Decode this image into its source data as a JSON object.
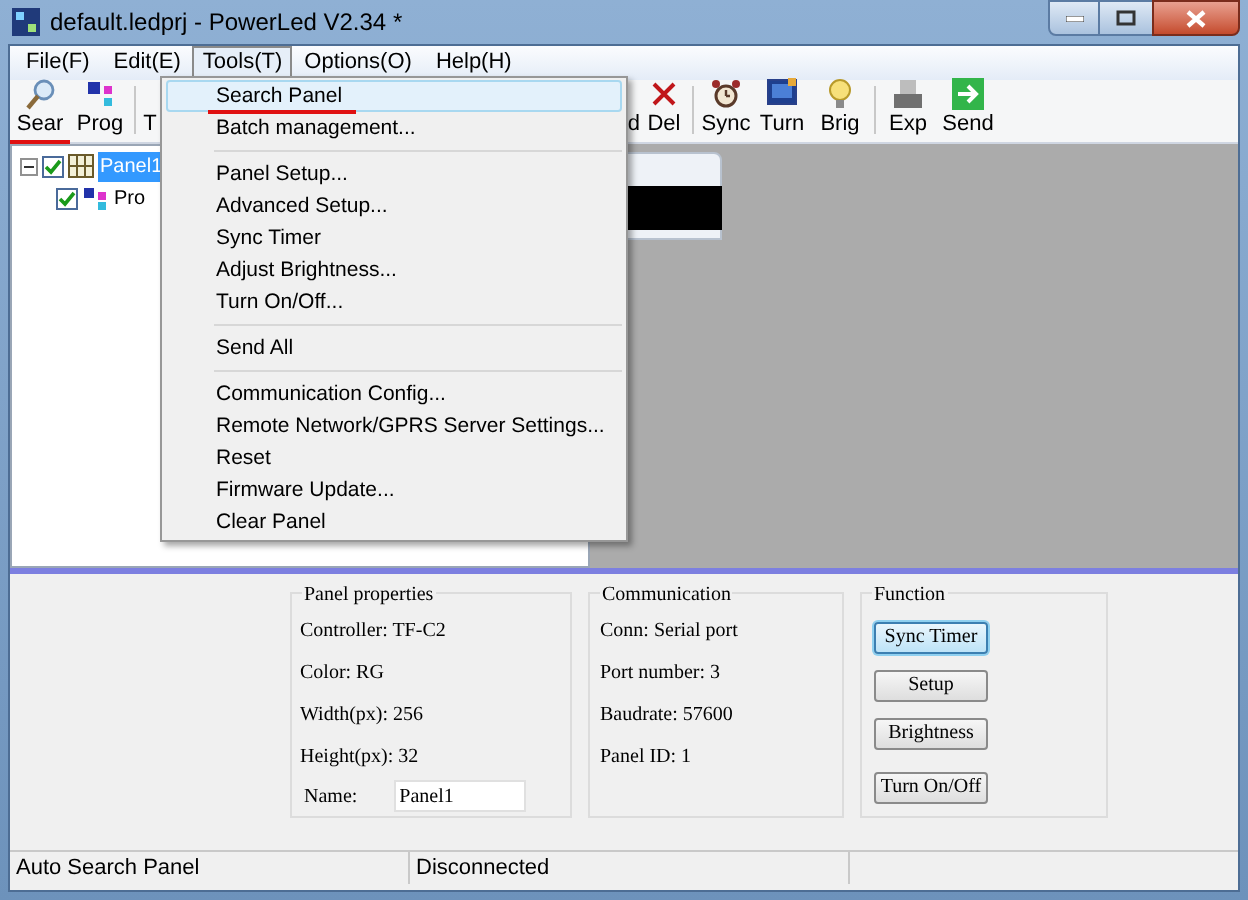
{
  "window": {
    "title": "default.ledprj - PowerLed V2.34 *"
  },
  "menu_bar": [
    {
      "label": "File(F)",
      "selected": false
    },
    {
      "label": "Edit(E)",
      "selected": false
    },
    {
      "label": "Tools(T)",
      "selected": true
    },
    {
      "label": "Options(O)",
      "selected": false
    },
    {
      "label": "Help(H)",
      "selected": false
    }
  ],
  "toolbar": [
    {
      "label": "Sear"
    },
    {
      "label": "Prog"
    },
    {
      "label": "T"
    },
    {
      "label": "d"
    },
    {
      "label": "Del"
    },
    {
      "label": "Sync"
    },
    {
      "label": "Turn"
    },
    {
      "label": "Brig"
    },
    {
      "label": "Exp"
    },
    {
      "label": "Send"
    }
  ],
  "tree": [
    {
      "label": "Panel1",
      "checked": true,
      "selected": true,
      "expanded": true,
      "children": [
        {
          "label": "Pro",
          "checked": true,
          "selected": false
        }
      ]
    }
  ],
  "tools_menu": [
    {
      "kind": "item",
      "label": "Search Panel",
      "highlighted": true,
      "annotated": true
    },
    {
      "kind": "item",
      "label": "Batch management...",
      "highlighted": false,
      "annotated": false
    },
    {
      "kind": "separator"
    },
    {
      "kind": "item",
      "label": "Panel Setup...",
      "highlighted": false,
      "annotated": false
    },
    {
      "kind": "item",
      "label": "Advanced Setup...",
      "highlighted": false,
      "annotated": false
    },
    {
      "kind": "item",
      "label": "Sync Timer",
      "highlighted": false,
      "annotated": false
    },
    {
      "kind": "item",
      "label": "Adjust Brightness...",
      "highlighted": false,
      "annotated": false
    },
    {
      "kind": "item",
      "label": "Turn On/Off...",
      "highlighted": false,
      "annotated": false
    },
    {
      "kind": "separator"
    },
    {
      "kind": "item",
      "label": "Send All",
      "highlighted": false,
      "annotated": false
    },
    {
      "kind": "separator"
    },
    {
      "kind": "item",
      "label": "Communication Config...",
      "highlighted": false,
      "annotated": false
    },
    {
      "kind": "item",
      "label": "Remote Network/GPRS Server Settings...",
      "highlighted": false,
      "annotated": false
    },
    {
      "kind": "item",
      "label": "Reset",
      "highlighted": false,
      "annotated": false
    },
    {
      "kind": "item",
      "label": "Firmware Update...",
      "highlighted": false,
      "annotated": false
    },
    {
      "kind": "item",
      "label": "Clear Panel",
      "highlighted": false,
      "annotated": false
    }
  ],
  "panel_properties": {
    "title": "Panel properties",
    "lines": [
      "Controller: TF-C2",
      "Color: RG",
      "Width(px): 256",
      "Height(px): 32"
    ],
    "name_label": "Name:",
    "name_value": "Panel1"
  },
  "communication": {
    "title": "Communication",
    "lines": [
      "Conn: Serial port",
      "Port number: 3",
      "Baudrate: 57600",
      "Panel ID: 1"
    ]
  },
  "function": {
    "title": "Function",
    "buttons": [
      {
        "label": "Sync Timer",
        "focused": true
      },
      {
        "label": "Setup",
        "focused": false
      },
      {
        "label": "Brightness",
        "focused": false
      },
      {
        "label": "Turn On/Off",
        "focused": false
      }
    ]
  },
  "status_bar": [
    "Auto Search Panel",
    "Disconnected"
  ]
}
